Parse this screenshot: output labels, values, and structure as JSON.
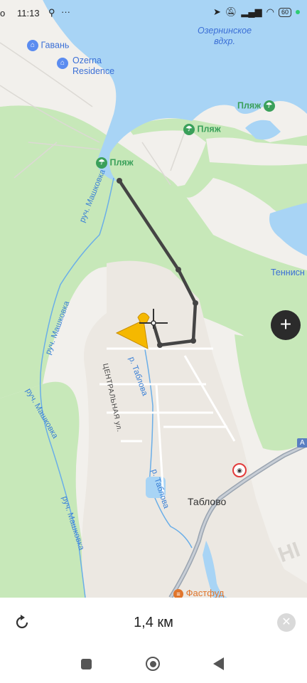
{
  "status_bar": {
    "time": "11:13",
    "left_letter": "о",
    "battery": "60"
  },
  "map": {
    "poi_havan": "Гавань",
    "poi_ozerna_1": "Ozerna",
    "poi_ozerna_2": "Residence",
    "reservoir_1": "Озернинское",
    "reservoir_2": "вдхр.",
    "beach_1": "Пляж",
    "beach_2": "Пляж",
    "beach_3": "Пляж",
    "tennis": "Теннисн",
    "stream_1": "руч. Машковка",
    "stream_2": "руч. Машковка",
    "stream_3": "руч. Машковка",
    "stream_4": "руч. Машковка",
    "river_1": "р. Таблова",
    "river_2": "р. Таблова",
    "street": "ЦЕНТРАЛЬНАЯ ул.",
    "town": "Таблово",
    "fastfood": "Фастфуд",
    "road_sign": "А",
    "hi_label": "HI"
  },
  "bottom_bar": {
    "distance": "1,4 км"
  },
  "colors": {
    "water": "#a8d4f5",
    "forest": "#c7e8b9",
    "land": "#f2f0ec",
    "route": "#444444",
    "marker": "#f5b800"
  }
}
